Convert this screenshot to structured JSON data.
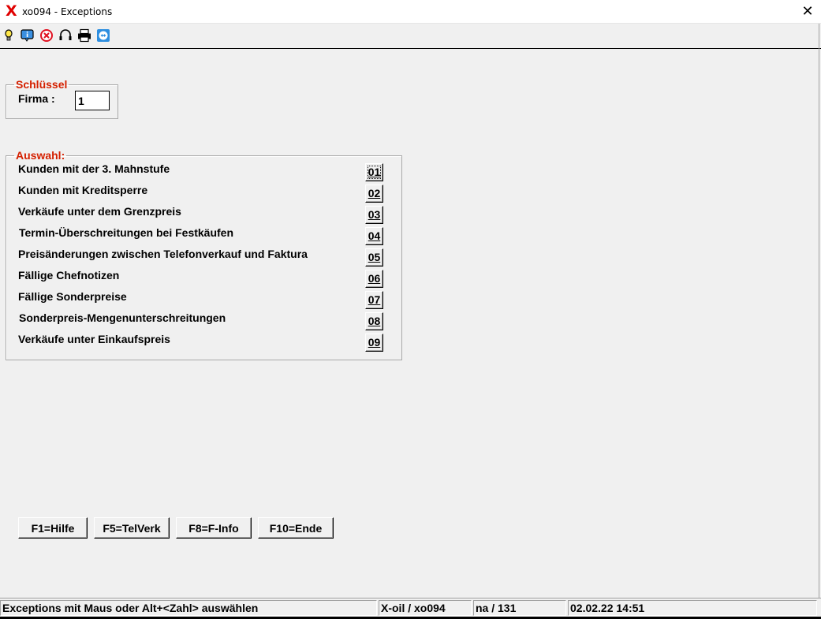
{
  "window": {
    "title": "xo094 - Exceptions",
    "app_icon": "X",
    "close_glyph": "✕"
  },
  "toolbar": {
    "icons": [
      "lightbulb-icon",
      "info-icon",
      "stop-icon",
      "headset-icon",
      "printer-icon",
      "remote-icon"
    ]
  },
  "schluessel": {
    "legend": "Schlüssel",
    "firma_label": "Firma :",
    "firma_value": "1"
  },
  "auswahl": {
    "legend": "Auswahl:",
    "items": [
      {
        "label": "Kunden mit der 3. Mahnstufe",
        "num": "01"
      },
      {
        "label": "Kunden mit Kreditsperre",
        "num": "02"
      },
      {
        "label": "Verkäufe unter dem Grenzpreis",
        "num": "03"
      },
      {
        "label": "Termin-Überschreitungen bei Festkäufen",
        "num": "04"
      },
      {
        "label": "Preisänderungen zwischen Telefonverkauf und Faktura",
        "num": "05"
      },
      {
        "label": "Fällige Chefnotizen",
        "num": "06"
      },
      {
        "label": "Fällige Sonderpreise",
        "num": "07"
      },
      {
        "label": "Sonderpreis-Mengenunterschreitungen",
        "num": "08"
      },
      {
        "label": "Verkäufe unter Einkaufspreis",
        "num": "09"
      }
    ]
  },
  "fkeys": {
    "f1": "F1=Hilfe",
    "f5": "F5=TelVerk",
    "f8": "F8=F-Info",
    "f10": "F10=Ende"
  },
  "status": {
    "message": "Exceptions mit Maus oder Alt+<Zahl> auswählen",
    "program": "X-oil / xo094",
    "user": "na / 131",
    "datetime": "02.02.22 14:51"
  },
  "colors": {
    "legend": "#d42000",
    "app_icon": "#e00000"
  }
}
